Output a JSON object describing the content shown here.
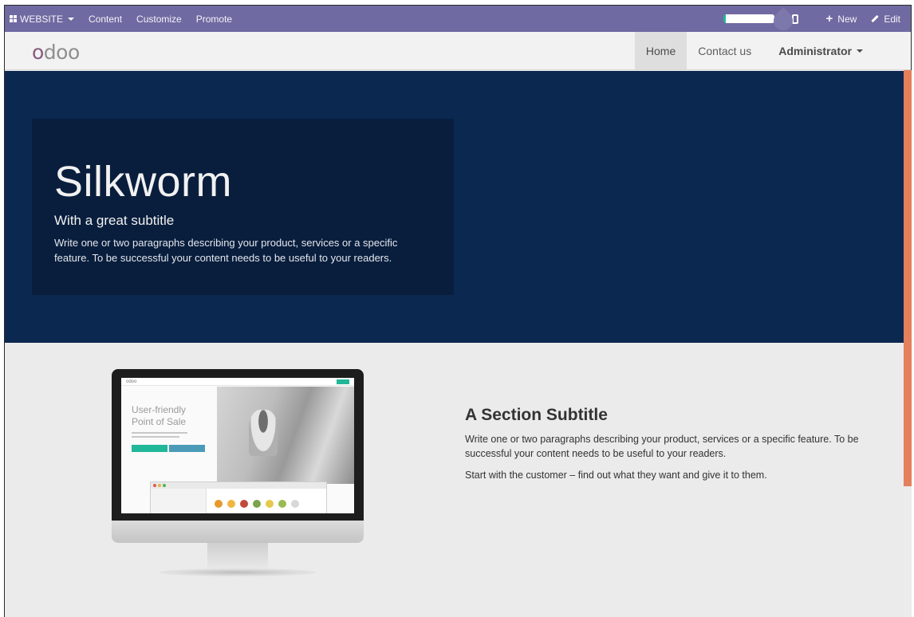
{
  "adminbar": {
    "website_label": "WEBSITE",
    "menu": [
      "Content",
      "Customize",
      "Promote"
    ],
    "new_label": "New",
    "edit_label": "Edit",
    "accent": "#6f6aa1"
  },
  "header": {
    "logo": {
      "o1": "o",
      "rest": "doo"
    },
    "nav": [
      "Home",
      "Contact us"
    ],
    "user": "Administrator"
  },
  "hero": {
    "title": "Silkworm",
    "subtitle": "With a great subtitle",
    "text": "Write one or two paragraphs describing your product, services or a specific feature. To be successful your content needs to be useful to your readers.",
    "background": "#0b2851"
  },
  "section": {
    "title": "A Section Subtitle",
    "paragraph1": "Write one or two paragraphs describing your product, services or a specific feature. To be successful your content needs to be useful to your readers.",
    "paragraph2": "Start with the customer – find out what they want and give it to them."
  },
  "illustration": {
    "logo": "odoo",
    "headline1": "User-friendly",
    "headline2": "Point of Sale"
  }
}
